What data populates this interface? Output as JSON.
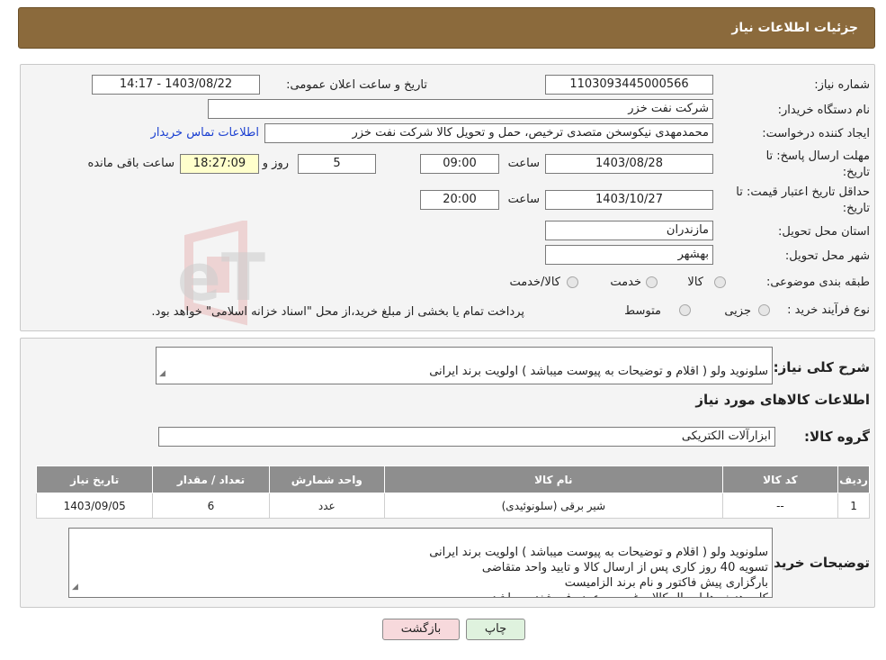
{
  "header": {
    "title": "جزئیات اطلاعات نیاز"
  },
  "watermark": {
    "text": "AriaTender.neT"
  },
  "form": {
    "need_number": {
      "label": "شماره نیاز:",
      "value": "1103093445000566"
    },
    "announce_date": {
      "label": "تاریخ و ساعت اعلان عمومی:",
      "value": "1403/08/22 - 14:17"
    },
    "buyer_org": {
      "label": "نام دستگاه خریدار:",
      "value": "شرکت نفت خزر"
    },
    "requester": {
      "label": "ایجاد کننده درخواست:",
      "value": "محمدمهدی نیکوسخن متصدی ترخیص، حمل و تحویل کالا شرکت نفت خزر",
      "contact_link": "اطلاعات تماس خریدار"
    },
    "reply_deadline": {
      "label_line1": "مهلت ارسال پاسخ: تا",
      "label_line2": "تاریخ:",
      "date": "1403/08/28",
      "time_label": "ساعت",
      "time": "09:00",
      "days": "5",
      "days_label": "روز و",
      "remaining": "18:27:09",
      "remaining_label": "ساعت باقی مانده"
    },
    "price_validity": {
      "label_line1": "حداقل تاریخ اعتبار قیمت: تا",
      "label_line2": "تاریخ:",
      "date": "1403/10/27",
      "time_label": "ساعت",
      "time": "20:00"
    },
    "province": {
      "label": "استان محل تحویل:",
      "value": "مازندران"
    },
    "city": {
      "label": "شهر محل تحویل:",
      "value": "بهشهر"
    },
    "category": {
      "label": "طبقه بندی موضوعی:",
      "options": [
        "کالا",
        "خدمت",
        "کالا/خدمت"
      ]
    },
    "process": {
      "label": "نوع فرآیند خرید :",
      "options": [
        "جزیی",
        "متوسط"
      ],
      "note": "پرداخت تمام یا بخشی از مبلغ خرید،از محل \"اسناد خزانه اسلامی\" خواهد بود."
    }
  },
  "details": {
    "summary_label": "شرح کلی نیاز:",
    "summary": "سلونوید ولو ( اقلام و توضیحات به پیوست میباشد ) اولویت برند ایرانی",
    "items_title": "اطلاعات کالاهای مورد نیاز",
    "group_label": "گروه کالا:",
    "group": "ابزارآلات الکتریکی",
    "table": {
      "headers": [
        "ردیف",
        "کد کالا",
        "نام کالا",
        "واحد شمارش",
        "تعداد / مقدار",
        "تاریخ نیاز"
      ],
      "rows": [
        [
          "1",
          "--",
          "شیر برقی (سلونوئیدی)",
          "عدد",
          "6",
          "1403/09/05"
        ]
      ]
    },
    "buyer_notes_label": "توضیحات خریدار:",
    "buyer_notes": "سلونوید ولو ( اقلام و توضیحات به پیوست میباشد ) اولویت برند ایرانی\nتسویه 40 روز کاری پس از ارسال کالا و تایید واحد متقاضی\nبارگزاری پیش فاکتور و نام برند الزامیست\nکلیه هزینه ها ارسال کالا و غیره به عهده فروشنده میباشد"
  },
  "buttons": {
    "print": "چاپ",
    "back": "بازگشت"
  },
  "colors": {
    "header_bg": "#8b6a3c",
    "link": "#1a3fd1",
    "table_header": "#8e8e8e",
    "back_btn": "#f7d9dc",
    "print_btn": "#dff2de"
  }
}
